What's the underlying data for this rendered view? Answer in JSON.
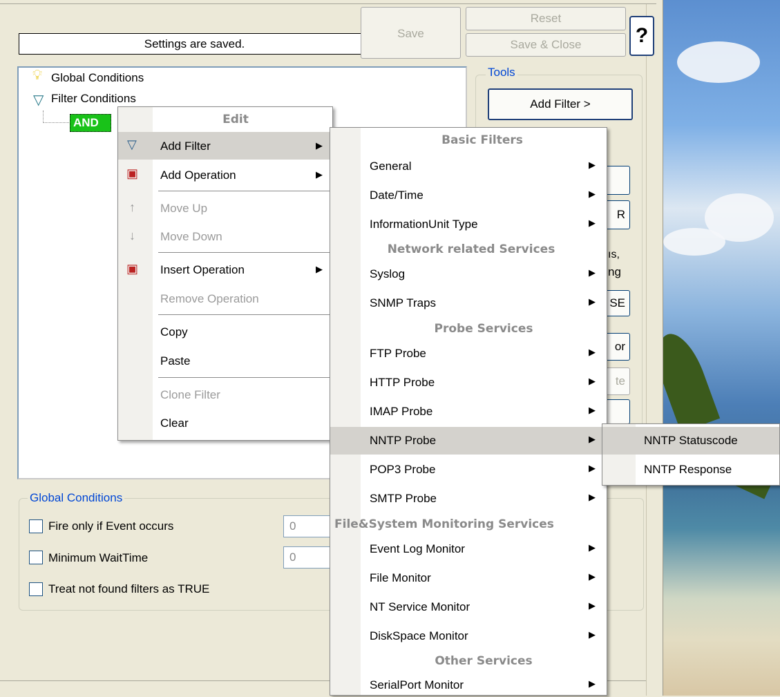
{
  "header": {
    "status_text": "Settings are saved.",
    "save_label": "Save",
    "reset_label": "Reset",
    "save_close_label": "Save & Close",
    "help_label": "?"
  },
  "tree": {
    "global_conditions_label": "Global Conditions",
    "filter_conditions_label": "Filter Conditions",
    "and_label": "AND"
  },
  "tools": {
    "title": "Tools",
    "add_filter_label": "Add Filter >",
    "partial_texts": [
      "R",
      "ıs,",
      "ng",
      "SE",
      "or",
      "te"
    ]
  },
  "global_conditions": {
    "title": "Global Conditions",
    "fire_only_label": "Fire only if Event occurs",
    "fire_only_value": "0",
    "min_wait_label": "Minimum WaitTime",
    "min_wait_value": "0",
    "treat_not_found_label": "Treat not found filters as TRUE"
  },
  "edit_menu": {
    "header": "Edit",
    "items": [
      {
        "label": "Add Filter",
        "icon": "funnel-icon",
        "submenu": true,
        "enabled": true
      },
      {
        "label": "Add Operation",
        "icon": "operation-icon",
        "submenu": true,
        "enabled": true
      },
      {
        "label": "Move Up",
        "icon": "arrow-up-icon",
        "submenu": false,
        "enabled": false
      },
      {
        "label": "Move Down",
        "icon": "arrow-down-icon",
        "submenu": false,
        "enabled": false
      },
      {
        "label": "Insert Operation",
        "icon": "operation-icon",
        "submenu": true,
        "enabled": true
      },
      {
        "label": "Remove Operation",
        "icon": "",
        "submenu": false,
        "enabled": false
      },
      {
        "label": "Copy",
        "icon": "",
        "submenu": false,
        "enabled": true
      },
      {
        "label": "Paste",
        "icon": "",
        "submenu": false,
        "enabled": true
      },
      {
        "label": "Clone Filter",
        "icon": "",
        "submenu": false,
        "enabled": false
      },
      {
        "label": "Clear",
        "icon": "",
        "submenu": false,
        "enabled": true
      }
    ]
  },
  "filter_menu": {
    "headers": [
      "Basic Filters",
      "Network related Services",
      "Probe Services",
      "File&System Monitoring Services",
      "Other Services"
    ],
    "basic": [
      "General",
      "Date/Time",
      "InformationUnit Type"
    ],
    "network": [
      "Syslog",
      "SNMP Traps"
    ],
    "probe": [
      "FTP Probe",
      "HTTP Probe",
      "IMAP Probe",
      "NNTP Probe",
      "POP3 Probe",
      "SMTP Probe"
    ],
    "filesystem": [
      "Event Log Monitor",
      "File Monitor",
      "NT Service Monitor",
      "DiskSpace Monitor"
    ],
    "other": [
      "SerialPort Monitor"
    ]
  },
  "nntp_menu": {
    "items": [
      "NNTP Statuscode",
      "NNTP Response"
    ]
  },
  "colors": {
    "accent": "#0046d5",
    "and_node": "#19c219",
    "highlight": "#d4d2cd"
  }
}
